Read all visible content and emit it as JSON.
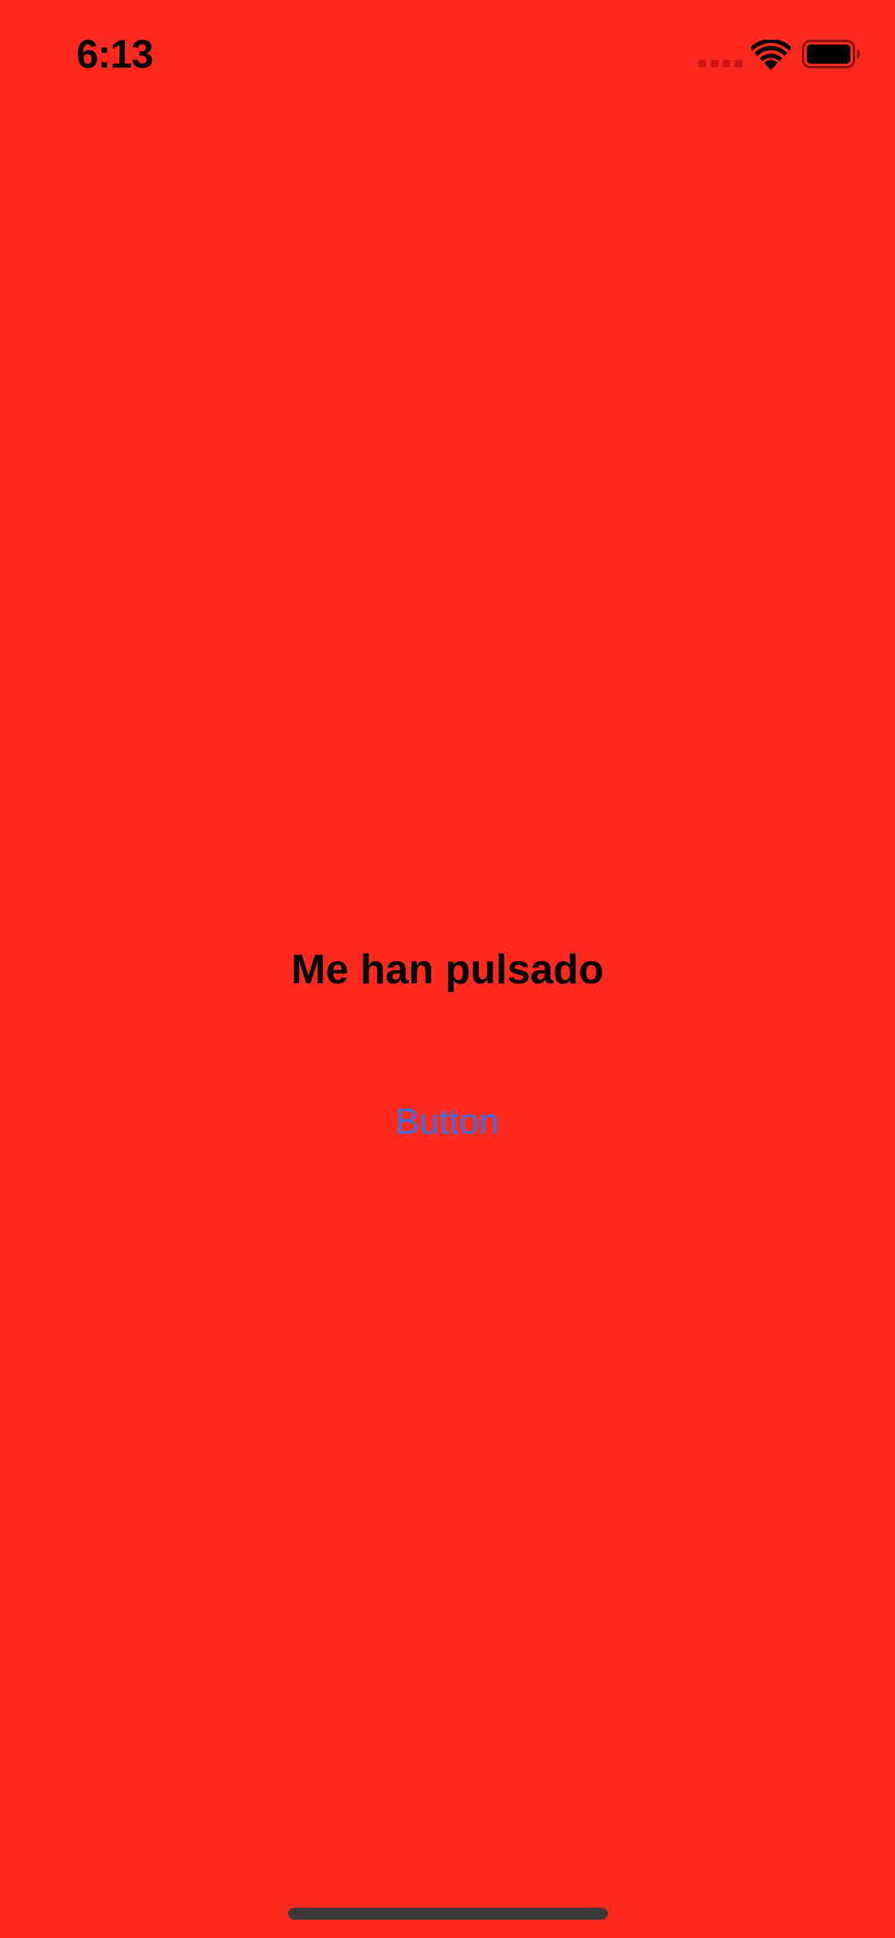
{
  "status_bar": {
    "time": "6:13",
    "icons": [
      "cellular-signal-icon",
      "wifi-icon",
      "battery-icon"
    ]
  },
  "main": {
    "label": "Me han pulsado",
    "button_label": "Button"
  },
  "colors": {
    "background": "#FF2A1F",
    "button_text": "#3E6FE0",
    "label_text": "#000000",
    "home_indicator": "#3A3A3A"
  }
}
